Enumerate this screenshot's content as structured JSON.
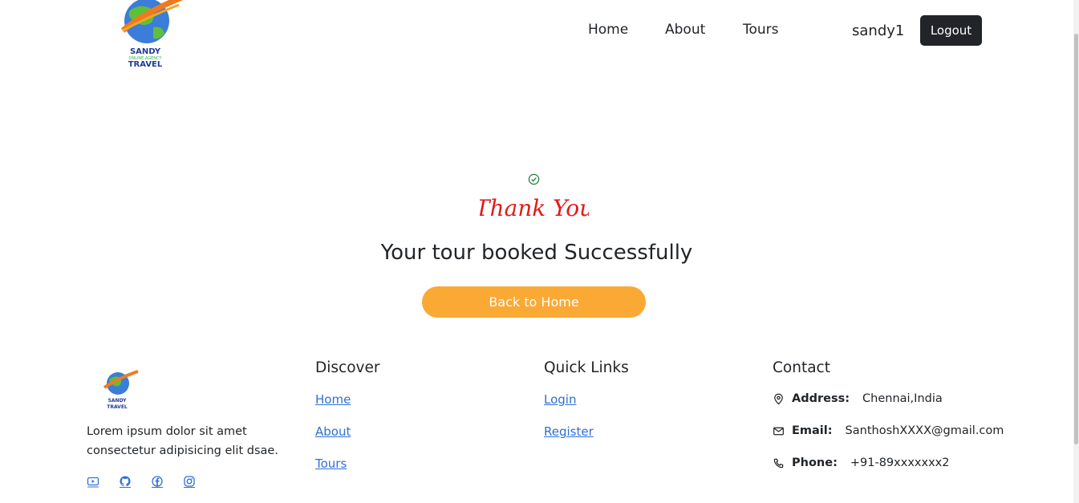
{
  "header": {
    "logo_text_line1": "SANDY",
    "logo_text_line2": "ONLINE AGENCY",
    "logo_text_line3": "TRAVEL",
    "nav": [
      "Home",
      "About",
      "Tours"
    ],
    "username": "sandy1",
    "logout_label": "Logout"
  },
  "main": {
    "check_icon": "check-circle-icon",
    "thankyou_text": "Thank You",
    "title": "Your tour booked Successfully",
    "back_button": "Back to Home",
    "accent_color": "#faa935"
  },
  "footer": {
    "description": "Lorem ipsum dolor sit amet consectetur adipisicing elit dsae.",
    "socials": [
      "youtube-icon",
      "github-icon",
      "facebook-icon",
      "instagram-icon"
    ],
    "discover": {
      "title": "Discover",
      "links": [
        "Home",
        "About",
        "Tours"
      ]
    },
    "quick_links": {
      "title": "Quick Links",
      "links": [
        "Login",
        "Register"
      ]
    },
    "contact": {
      "title": "Contact",
      "items": [
        {
          "icon": "map-pin-icon",
          "label": "Address:",
          "value": "Chennai,India"
        },
        {
          "icon": "mail-icon",
          "label": "Email:",
          "value": "SanthoshXXXX@gmail.com"
        },
        {
          "icon": "phone-icon",
          "label": "Phone:",
          "value": "+91-89xxxxxxx2"
        }
      ]
    }
  }
}
